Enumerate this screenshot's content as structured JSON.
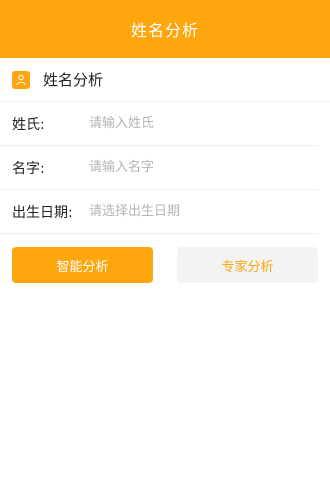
{
  "topbar": {
    "title": "姓名分析"
  },
  "section": {
    "title": "姓名分析",
    "icon": "user-icon"
  },
  "form": {
    "surname": {
      "label": "姓氏:",
      "placeholder": "请输入姓氏",
      "value": ""
    },
    "name": {
      "label": "名字:",
      "placeholder": "请输入名字",
      "value": ""
    },
    "birthdate": {
      "label": "出生日期:",
      "placeholder": "请选择出生日期",
      "value": ""
    }
  },
  "buttons": {
    "smart_analysis": "智能分析",
    "expert_analysis": "专家分析"
  },
  "colors": {
    "accent": "#fda60d",
    "secondary_bg": "#f3f3f3",
    "placeholder": "#b5b5b5",
    "divider": "#eeeeee"
  }
}
